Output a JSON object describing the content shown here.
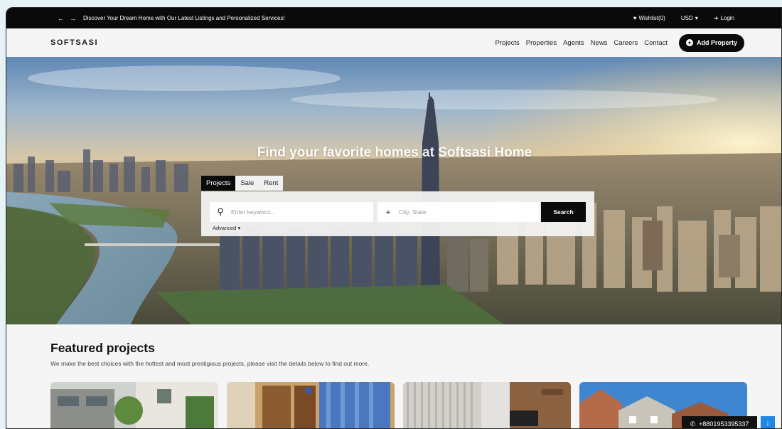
{
  "topbar": {
    "back_icon": "arrow-left-icon",
    "forward_icon": "arrow-right-icon",
    "announcement": "Discover Your Dream Home with Our Latest Listings and Personalized Services!",
    "wishlist": "Wishlist(0)",
    "currency": "USD",
    "login": "Login"
  },
  "nav": {
    "logo": "SOFTSASI",
    "items": [
      "Projects",
      "Properties",
      "Agents",
      "News",
      "Careers",
      "Contact"
    ],
    "add_property": "Add Property"
  },
  "hero": {
    "title": "Find your favorite homes at Softsasi Home",
    "tabs": [
      "Projects",
      "Sale",
      "Rent"
    ],
    "active_tab": "Projects",
    "keyword_placeholder": "Enter keyword...",
    "city_placeholder": "City, State",
    "search_button": "Search",
    "advanced": "Advanced"
  },
  "featured": {
    "title": "Featured projects",
    "subtitle": "We make the best choices with the hottest and most prestigious projects, please visit the details below to find out more."
  },
  "contact": {
    "phone": "+8801953395337"
  },
  "colors": {
    "accent": "#0a0a0a",
    "scroll_button": "#1e88e5"
  }
}
